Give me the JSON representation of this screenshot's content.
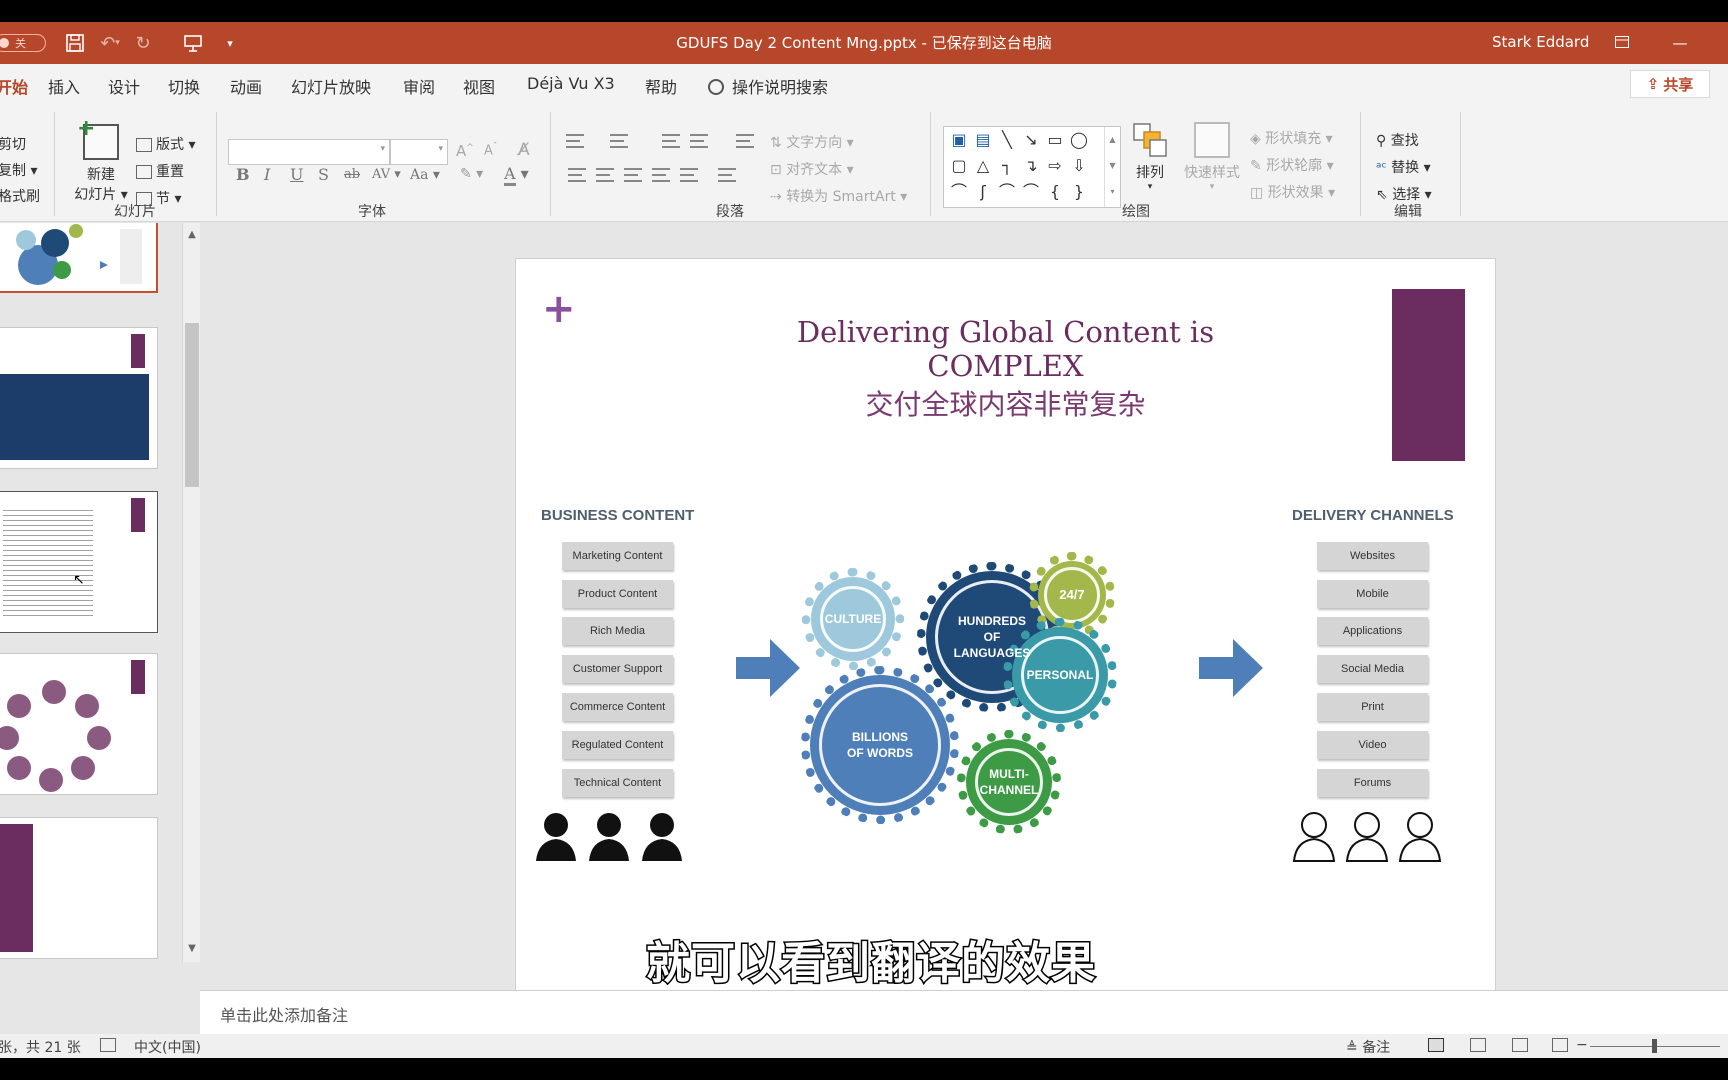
{
  "titlebar": {
    "autosave_label": "关",
    "doc_title": "GDUFS Day 2 Content Mng.pptx  -  已保存到这台电脑",
    "user_name": "Stark Eddard"
  },
  "tabs": [
    "开始",
    "插入",
    "设计",
    "切换",
    "动画",
    "幻灯片放映",
    "审阅",
    "视图",
    "Déjà Vu X3",
    "帮助"
  ],
  "tell_me": "操作说明搜索",
  "share_label": "共享",
  "ribbon": {
    "clipboard": {
      "cut": "剪切",
      "copy": "复制",
      "format_painter": "格式刷"
    },
    "slides": {
      "new_slide_line1": "新建",
      "new_slide_line2": "幻灯片",
      "layout": "版式",
      "reset": "重置",
      "section": "节",
      "group": "幻灯片"
    },
    "font": {
      "group": "字体"
    },
    "paragraph": {
      "text_direction": "文字方向",
      "align_text": "对齐文本",
      "smartart": "转换为 SmartArt",
      "group": "段落"
    },
    "drawing": {
      "arrange": "排列",
      "quick_styles": "快速样式",
      "shape_fill": "形状填充",
      "shape_outline": "形状轮廓",
      "shape_effects": "形状效果",
      "group": "绘图"
    },
    "editing": {
      "find": "查找",
      "replace": "替换",
      "select": "选择",
      "group": "编辑"
    }
  },
  "slide": {
    "title_en_line1": "Delivering Global Content is",
    "title_en_line2": "COMPLEX",
    "title_cn": "交付全球内容非常复杂",
    "business_heading": "BUSINESS CONTENT",
    "business_items": [
      "Marketing Content",
      "Product Content",
      "Rich Media",
      "Customer Support",
      "Commerce Content",
      "Regulated  Content",
      "Technical Content"
    ],
    "delivery_heading": "DELIVERY CHANNELS",
    "delivery_items": [
      "Websites",
      "Mobile",
      "Applications",
      "Social Media",
      "Print",
      "Video",
      "Forums"
    ],
    "gears": {
      "culture": "CULTURE",
      "hundreds_1": "HUNDREDS",
      "hundreds_2": "OF",
      "hundreds_3": "LANGUAGES",
      "always": "24/7",
      "personal": "PERSONAL",
      "billions_1": "BILLIONS",
      "billions_2": "OF WORDS",
      "multi_1": "MULTI-",
      "multi_2": "CHANNEL"
    },
    "subtitle": "就可以看到翻译的效果"
  },
  "notes_placeholder": "单击此处添加备注",
  "status": {
    "slide_count": "张，共 21 张",
    "language": "中文(中国)",
    "notes_button": "备注"
  },
  "colors": {
    "accent": "#b7472a",
    "slide_purple": "#6b2c5f",
    "culture_gear": "#9ec9dc",
    "languages_gear": "#1f4a78",
    "always_gear": "#a3b84b",
    "personal_gear": "#3a9aa8",
    "billions_gear": "#4f7fb9",
    "multichannel_gear": "#3d9b45"
  }
}
